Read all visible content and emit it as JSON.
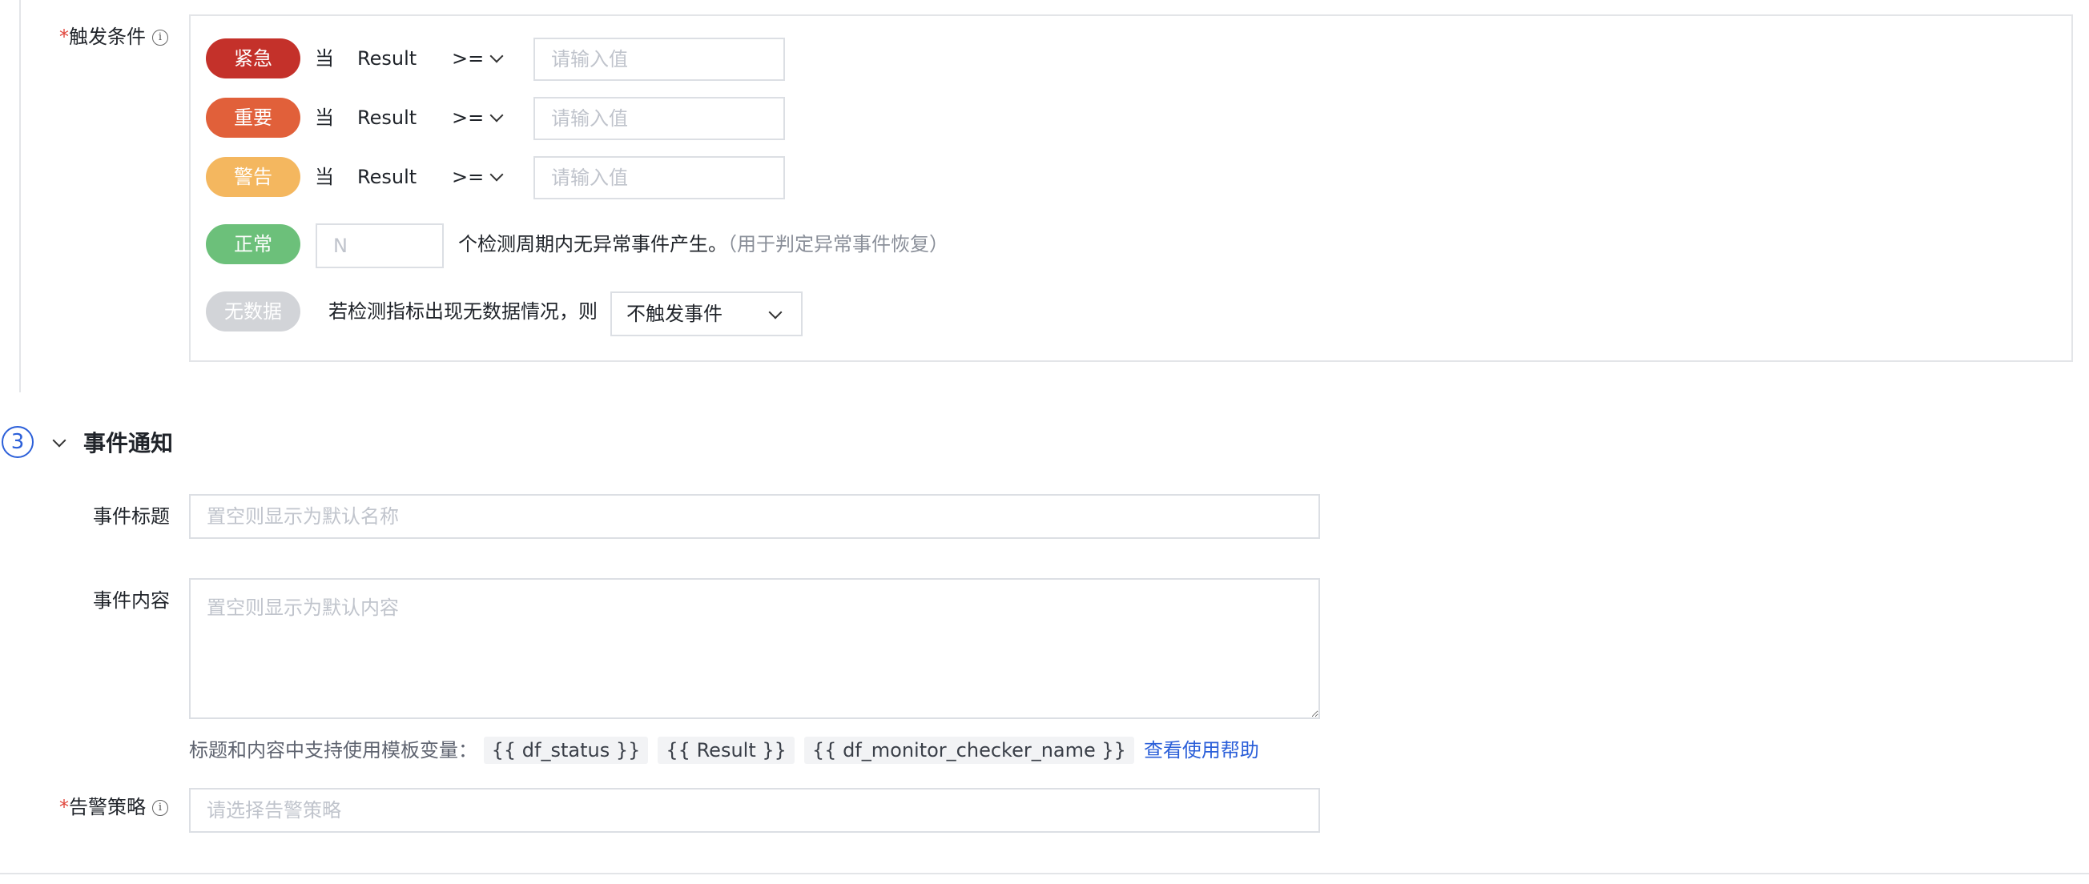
{
  "trigger": {
    "label": "触发条件",
    "required_mark": "*",
    "info_icon": "info-circle-icon",
    "rows": [
      {
        "level": "紧急",
        "when": "当",
        "field": "Result",
        "operator": ">=",
        "placeholder": "请输入值",
        "color": "#c4312a"
      },
      {
        "level": "重要",
        "when": "当",
        "field": "Result",
        "operator": ">=",
        "placeholder": "请输入值",
        "color": "#e1603a"
      },
      {
        "level": "警告",
        "when": "当",
        "field": "Result",
        "operator": ">=",
        "placeholder": "请输入值",
        "color": "#f4b75f"
      }
    ],
    "normal": {
      "level": "正常",
      "placeholder": "N",
      "text": "个检测周期内无异常事件产生。",
      "hint": "（用于判定异常事件恢复）",
      "color": "#6cc07a"
    },
    "nodata": {
      "level": "无数据",
      "text": "若检测指标出现无数据情况，则",
      "select_value": "不触发事件",
      "color": "#d2d4d8"
    }
  },
  "notification": {
    "step": "3",
    "title": "事件通知",
    "event_title": {
      "label": "事件标题",
      "placeholder": "置空则显示为默认名称"
    },
    "event_content": {
      "label": "事件内容",
      "placeholder": "置空则显示为默认内容"
    },
    "template_hint": "标题和内容中支持使用模板变量：",
    "variables": [
      "{{ df_status }}",
      "{{ Result }}",
      "{{ df_monitor_checker_name }}"
    ],
    "help_link": "查看使用帮助",
    "alert_policy": {
      "label": "告警策略",
      "required_mark": "*",
      "placeholder": "请选择告警策略",
      "info_icon": "info-circle-icon"
    }
  },
  "colors": {
    "accent": "#2b5fd9",
    "required": "#e0463c"
  }
}
